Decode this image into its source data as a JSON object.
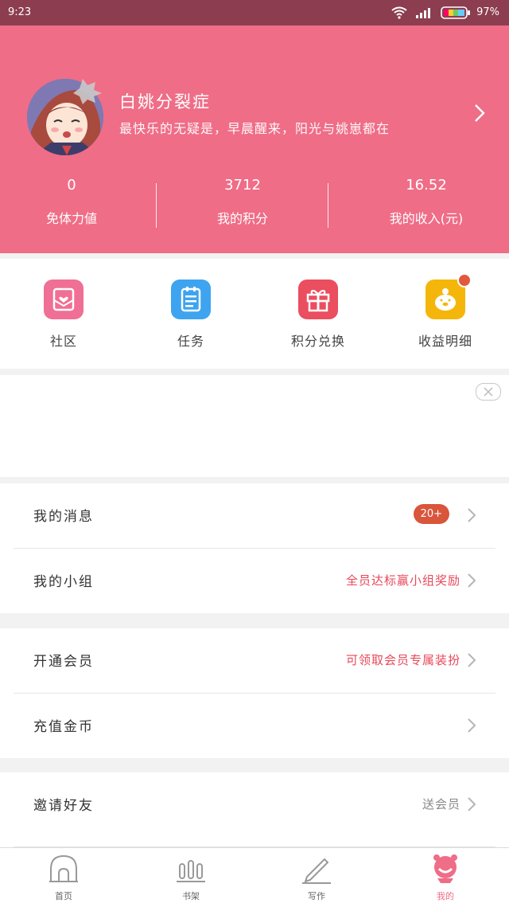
{
  "status_bar": {
    "time": "9:23",
    "battery": "97%"
  },
  "profile": {
    "username": "白姚分裂症",
    "signature": "最快乐的无疑是，早晨醒来，阳光与姚崽都在"
  },
  "stats": [
    {
      "value": "0",
      "label": "免体力値"
    },
    {
      "value": "3712",
      "label": "我的积分"
    },
    {
      "value": "16.52",
      "label": "我的收入(元)"
    }
  ],
  "shortcuts": [
    {
      "label": "社区",
      "icon": "community-heart-icon",
      "color": "#f06f94"
    },
    {
      "label": "任务",
      "icon": "task-clipboard-icon",
      "color": "#3ea4ef"
    },
    {
      "label": "积分兑换",
      "icon": "gift-box-icon",
      "color": "#ea4e5f"
    },
    {
      "label": "收益明细",
      "icon": "piggy-bank-icon",
      "color": "#f5b60c"
    }
  ],
  "menu": {
    "messages": {
      "title": "我的消息",
      "badge": "20+"
    },
    "groups": {
      "title": "我的小组",
      "extra": "全员达标赢小组奖励"
    },
    "vip": {
      "title": "开通会员",
      "extra": "可领取会员专属装扮"
    },
    "recharge": {
      "title": "充值金币"
    },
    "invite": {
      "title": "邀请好友",
      "extra": "送会员"
    }
  },
  "tabs": [
    {
      "label": "首页",
      "icon": "home-icon"
    },
    {
      "label": "书架",
      "icon": "bookshelf-icon"
    },
    {
      "label": "写作",
      "icon": "pen-icon"
    },
    {
      "label": "我的",
      "icon": "profile-icon",
      "active": true
    }
  ],
  "colors": {
    "brand": "#ef6d87",
    "status_bar": "#8c3d4f",
    "accent_red": "#e8485a",
    "badge": "#d9553b"
  }
}
